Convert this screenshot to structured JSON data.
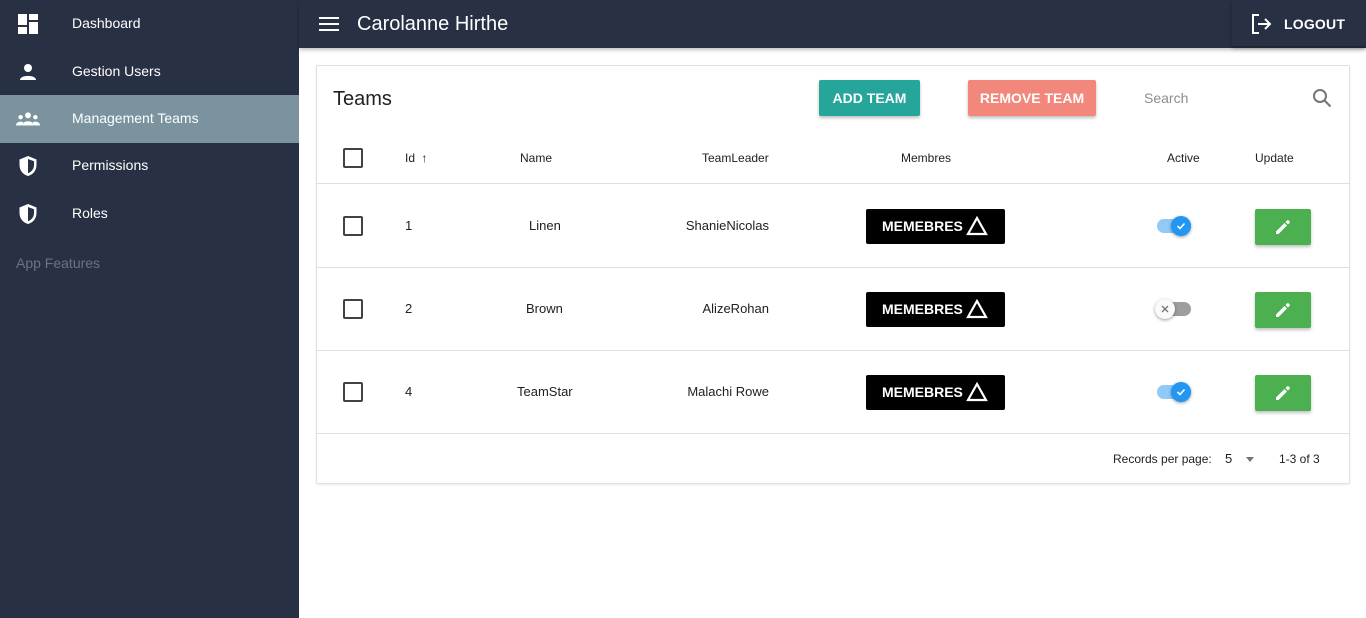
{
  "sidebar": {
    "items": [
      {
        "label": "Dashboard",
        "icon": "dashboard-icon",
        "active": false
      },
      {
        "label": "Gestion Users",
        "icon": "person-icon",
        "active": false
      },
      {
        "label": "Management Teams",
        "icon": "people-icon",
        "active": true
      },
      {
        "label": "Permissions",
        "icon": "shield-icon",
        "active": false
      },
      {
        "label": "Roles",
        "icon": "shield-icon",
        "active": false
      }
    ],
    "subheader": "App Features"
  },
  "header": {
    "title": "Carolanne Hirthe",
    "logout_label": "LOGOUT"
  },
  "teams": {
    "title": "Teams",
    "add_label": "ADD TEAM",
    "remove_label": "REMOVE TEAM",
    "search_placeholder": "Search",
    "search_value": "",
    "columns": [
      "Id",
      "Name",
      "TeamLeader",
      "Membres",
      "Active",
      "Update"
    ],
    "sort_indicator": "↑",
    "rows": [
      {
        "id": "1",
        "name": "Linen",
        "leader": "ShanieNicolas",
        "members_label": "MEMEBRES",
        "active": true,
        "selected": false
      },
      {
        "id": "2",
        "name": "Brown",
        "leader": "AlizeRohan",
        "members_label": "MEMEBRES",
        "active": false,
        "selected": false
      },
      {
        "id": "4",
        "name": "TeamStar",
        "leader": "Malachi Rowe",
        "members_label": "MEMEBRES",
        "active": true,
        "selected": false
      }
    ],
    "footer": {
      "rpp_label": "Records per page:",
      "rpp_value": "5",
      "page_info": "1-3 of 3"
    }
  },
  "colors": {
    "sidebar_bg": "#283044",
    "active_item": "#7a939e",
    "add_button": "#26a69a",
    "remove_button": "#f2877c",
    "update_button": "#4caf50",
    "toggle_on": "#2196f3"
  }
}
